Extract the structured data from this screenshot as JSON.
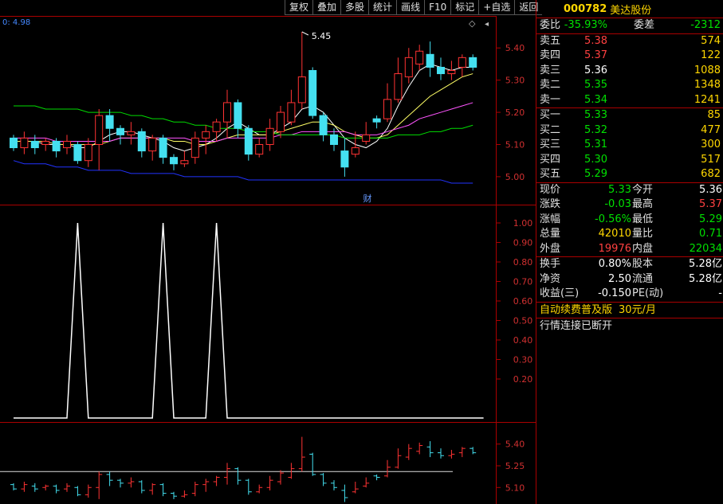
{
  "toolbar": [
    "复权",
    "叠加",
    "多股",
    "统计",
    "画线",
    "F10",
    "标记",
    "+自选",
    "返回"
  ],
  "panel": {
    "code": "000782",
    "name": "美达股份",
    "weibi_label": "委比",
    "weibi": "-35.93%",
    "weicha_label": "委差",
    "weicha": "-2312",
    "sells": [
      {
        "label": "卖五",
        "price": "5.38",
        "vol": "574",
        "cls": "red"
      },
      {
        "label": "卖四",
        "price": "5.37",
        "vol": "122",
        "cls": "red"
      },
      {
        "label": "卖三",
        "price": "5.36",
        "vol": "1088",
        "cls": "white"
      },
      {
        "label": "卖二",
        "price": "5.35",
        "vol": "1348",
        "cls": "green"
      },
      {
        "label": "卖一",
        "price": "5.34",
        "vol": "1241",
        "cls": "green"
      }
    ],
    "buys": [
      {
        "label": "买一",
        "price": "5.33",
        "vol": "85",
        "cls": "green"
      },
      {
        "label": "买二",
        "price": "5.32",
        "vol": "477",
        "cls": "green"
      },
      {
        "label": "买三",
        "price": "5.31",
        "vol": "300",
        "cls": "green"
      },
      {
        "label": "买四",
        "price": "5.30",
        "vol": "517",
        "cls": "green"
      },
      {
        "label": "买五",
        "price": "5.29",
        "vol": "682",
        "cls": "green"
      }
    ],
    "stats1": [
      {
        "l1": "现价",
        "v1": "5.33",
        "c1": "green",
        "l2": "今开",
        "v2": "5.36",
        "c2": "white"
      },
      {
        "l1": "涨跌",
        "v1": "-0.03",
        "c1": "green",
        "l2": "最高",
        "v2": "5.37",
        "c2": "red"
      },
      {
        "l1": "涨幅",
        "v1": "-0.56%",
        "c1": "green",
        "l2": "最低",
        "v2": "5.29",
        "c2": "green"
      },
      {
        "l1": "总量",
        "v1": "42010",
        "c1": "yellow",
        "l2": "量比",
        "v2": "0.71",
        "c2": "green"
      },
      {
        "l1": "外盘",
        "v1": "19976",
        "c1": "red",
        "l2": "内盘",
        "v2": "22034",
        "c2": "green"
      }
    ],
    "stats2": [
      {
        "l1": "换手",
        "v1": "0.80%",
        "c1": "white",
        "l2": "股本",
        "v2": "5.28亿",
        "c2": "white"
      },
      {
        "l1": "净资",
        "v1": "2.50",
        "c1": "white",
        "l2": "流通",
        "v2": "5.28亿",
        "c2": "white"
      },
      {
        "l1": "收益(三)",
        "v1": "-0.150",
        "c1": "white",
        "l2": "PE(动)",
        "v2": "-",
        "c2": "white"
      }
    ],
    "ad_text": "自动续费普及版",
    "ad_price": "30元/月",
    "status": "行情连接已断开"
  },
  "chart_data": [
    {
      "type": "candlestick",
      "top_left_label": "0: 4.98",
      "peak_label": "5.45",
      "event_marker": "财",
      "y_ticks": [
        "5.40",
        "5.30",
        "5.20",
        "5.10",
        "5.00"
      ],
      "ylim": [
        4.98,
        5.45
      ],
      "candles": [
        [
          5.12,
          5.09,
          5.13,
          5.08
        ],
        [
          5.09,
          5.12,
          5.14,
          5.07
        ],
        [
          5.11,
          5.09,
          5.13,
          5.07
        ],
        [
          5.1,
          5.11,
          5.12,
          5.08
        ],
        [
          5.11,
          5.08,
          5.12,
          5.06
        ],
        [
          5.09,
          5.11,
          5.13,
          5.07
        ],
        [
          5.1,
          5.05,
          5.11,
          5.04
        ],
        [
          5.05,
          5.1,
          5.12,
          5.03
        ],
        [
          5.1,
          5.19,
          5.21,
          5.02
        ],
        [
          5.19,
          5.15,
          5.21,
          5.11
        ],
        [
          5.15,
          5.13,
          5.16,
          5.1
        ],
        [
          5.13,
          5.14,
          5.17,
          5.1
        ],
        [
          5.14,
          5.08,
          5.15,
          5.06
        ],
        [
          5.08,
          5.12,
          5.13,
          5.05
        ],
        [
          5.12,
          5.06,
          5.13,
          5.04
        ],
        [
          5.06,
          5.04,
          5.07,
          5.02
        ],
        [
          5.04,
          5.05,
          5.08,
          5.03
        ],
        [
          5.06,
          5.12,
          5.14,
          5.04
        ],
        [
          5.12,
          5.14,
          5.16,
          5.07
        ],
        [
          5.14,
          5.17,
          5.18,
          5.11
        ],
        [
          5.17,
          5.23,
          5.27,
          5.12
        ],
        [
          5.23,
          5.15,
          5.24,
          5.12
        ],
        [
          5.15,
          5.07,
          5.16,
          5.05
        ],
        [
          5.07,
          5.1,
          5.12,
          5.06
        ],
        [
          5.1,
          5.15,
          5.18,
          5.08
        ],
        [
          5.14,
          5.2,
          5.22,
          5.12
        ],
        [
          5.17,
          5.23,
          5.27,
          5.16
        ],
        [
          5.23,
          5.31,
          5.45,
          5.21
        ],
        [
          5.33,
          5.19,
          5.34,
          5.18
        ],
        [
          5.19,
          5.13,
          5.2,
          5.11
        ],
        [
          5.13,
          5.1,
          5.15,
          5.08
        ],
        [
          5.08,
          5.03,
          5.12,
          5.0
        ],
        [
          5.07,
          5.09,
          5.14,
          5.06
        ],
        [
          5.11,
          5.13,
          5.17,
          5.1
        ],
        [
          5.18,
          5.17,
          5.19,
          5.15
        ],
        [
          5.18,
          5.24,
          5.29,
          5.17
        ],
        [
          5.24,
          5.32,
          5.37,
          5.23
        ],
        [
          5.31,
          5.37,
          5.4,
          5.29
        ],
        [
          5.35,
          5.39,
          5.41,
          5.33
        ],
        [
          5.38,
          5.34,
          5.42,
          5.31
        ],
        [
          5.34,
          5.32,
          5.37,
          5.3
        ],
        [
          5.32,
          5.33,
          5.36,
          5.3
        ],
        [
          5.34,
          5.37,
          5.38,
          5.31
        ],
        [
          5.37,
          5.34,
          5.38,
          5.33
        ]
      ],
      "lines": [
        {
          "color": "#ffffff",
          "values": [
            5.11,
            5.11,
            5.11,
            5.1,
            5.1,
            5.1,
            5.09,
            5.09,
            5.11,
            5.13,
            5.14,
            5.14,
            5.13,
            5.12,
            5.11,
            5.09,
            5.08,
            5.09,
            5.1,
            5.12,
            5.15,
            5.17,
            5.15,
            5.13,
            5.13,
            5.15,
            5.17,
            5.21,
            5.22,
            5.2,
            5.16,
            5.12,
            5.1,
            5.09,
            5.11,
            5.15,
            5.22,
            5.28,
            5.33,
            5.35,
            5.34,
            5.33,
            5.34,
            5.34
          ]
        },
        {
          "color": "#ffff66",
          "values": [
            5.11,
            5.11,
            5.11,
            5.11,
            5.1,
            5.1,
            5.1,
            5.1,
            5.1,
            5.11,
            5.12,
            5.12,
            5.12,
            5.12,
            5.12,
            5.11,
            5.11,
            5.1,
            5.1,
            5.11,
            5.12,
            5.13,
            5.13,
            5.13,
            5.13,
            5.14,
            5.15,
            5.16,
            5.17,
            5.17,
            5.16,
            5.14,
            5.13,
            5.12,
            5.12,
            5.13,
            5.16,
            5.19,
            5.22,
            5.25,
            5.27,
            5.29,
            5.31,
            5.32
          ]
        },
        {
          "color": "#ff55ff",
          "values": [
            5.12,
            5.12,
            5.12,
            5.12,
            5.11,
            5.11,
            5.11,
            5.11,
            5.11,
            5.11,
            5.12,
            5.12,
            5.12,
            5.12,
            5.12,
            5.12,
            5.12,
            5.11,
            5.11,
            5.11,
            5.12,
            5.12,
            5.12,
            5.12,
            5.12,
            5.13,
            5.13,
            5.14,
            5.14,
            5.14,
            5.14,
            5.14,
            5.13,
            5.13,
            5.13,
            5.14,
            5.15,
            5.16,
            5.18,
            5.19,
            5.2,
            5.21,
            5.22,
            5.23
          ]
        },
        {
          "color": "#00dd00",
          "values": [
            5.22,
            5.22,
            5.22,
            5.21,
            5.21,
            5.21,
            5.21,
            5.2,
            5.2,
            5.2,
            5.2,
            5.19,
            5.19,
            5.18,
            5.18,
            5.17,
            5.17,
            5.16,
            5.16,
            5.15,
            5.15,
            5.15,
            5.14,
            5.14,
            5.14,
            5.13,
            5.13,
            5.13,
            5.13,
            5.13,
            5.13,
            5.12,
            5.12,
            5.12,
            5.12,
            5.12,
            5.13,
            5.13,
            5.13,
            5.14,
            5.14,
            5.15,
            5.15,
            5.16
          ]
        },
        {
          "color": "#2233ff",
          "values": [
            5.05,
            5.04,
            5.04,
            5.04,
            5.03,
            5.03,
            5.03,
            5.02,
            5.02,
            5.02,
            5.02,
            5.01,
            5.01,
            5.01,
            5.01,
            5.01,
            5.0,
            5.0,
            5.0,
            5.0,
            5.0,
            5.0,
            4.99,
            4.99,
            4.99,
            4.99,
            4.99,
            4.99,
            4.99,
            4.99,
            4.99,
            4.99,
            4.99,
            4.99,
            4.99,
            4.99,
            4.99,
            4.99,
            4.99,
            4.99,
            4.99,
            4.98,
            4.98,
            4.98
          ]
        }
      ]
    },
    {
      "type": "line",
      "y_ticks": [
        "1.00",
        "0.90",
        "0.80",
        "0.70",
        "0.60",
        "0.50",
        "0.40",
        "0.30",
        "0.20"
      ],
      "ylim": [
        0,
        1
      ],
      "values": [
        0,
        0,
        0,
        0,
        0,
        0,
        1,
        0,
        0,
        0,
        0,
        0,
        0,
        0,
        1,
        0,
        0,
        0,
        0,
        1,
        0,
        0,
        0,
        0,
        0,
        0,
        0,
        0,
        0,
        0,
        0,
        0,
        0,
        0,
        0,
        0,
        0,
        0,
        0,
        0,
        0,
        0,
        0,
        0,
        0
      ]
    },
    {
      "type": "tick",
      "y_ticks": [
        "5.40",
        "5.25",
        "5.10"
      ],
      "ylim": [
        5.03,
        5.47
      ],
      "baseline": 5.21
    }
  ]
}
